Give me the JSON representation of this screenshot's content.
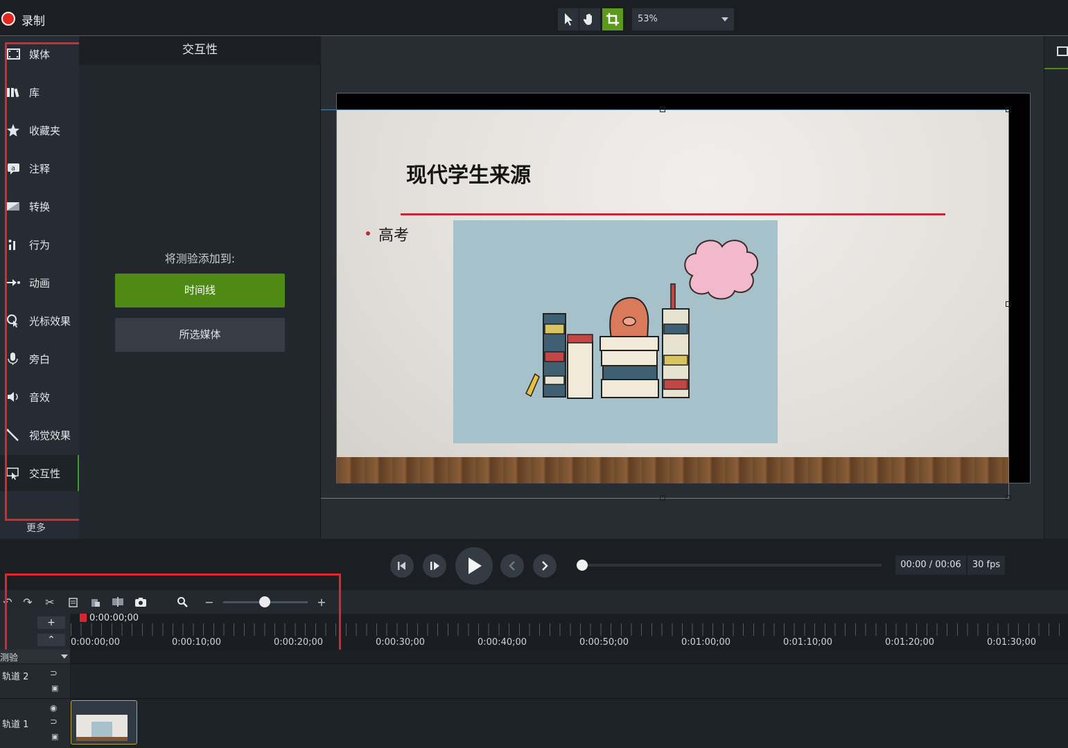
{
  "app": {
    "record_label": "录制",
    "zoom_value": "53%"
  },
  "tools": {
    "items": [
      {
        "label": "媒体",
        "icon": "film-strip-icon"
      },
      {
        "label": "库",
        "icon": "library-books-icon"
      },
      {
        "label": "收藏夹",
        "icon": "star-icon"
      },
      {
        "label": "注释",
        "icon": "annotation-icon"
      },
      {
        "label": "转换",
        "icon": "transition-icon"
      },
      {
        "label": "行为",
        "icon": "behavior-icon"
      },
      {
        "label": "动画",
        "icon": "animation-arrow-icon"
      },
      {
        "label": "光标效果",
        "icon": "cursor-effect-icon"
      },
      {
        "label": "旁白",
        "icon": "microphone-icon"
      },
      {
        "label": "音效",
        "icon": "speaker-icon"
      },
      {
        "label": "视觉效果",
        "icon": "magic-wand-icon"
      },
      {
        "label": "交互性",
        "icon": "interactivity-icon"
      }
    ],
    "active": "交互性",
    "more_label": "更多"
  },
  "panel": {
    "title": "交互性",
    "add_quiz_label": "将测验添加到:",
    "timeline_button": "时间线",
    "selected_media_button": "所选媒体"
  },
  "slide": {
    "title": "现代学生来源",
    "bullet": "高考"
  },
  "playback": {
    "time": "00:00 / 00:06",
    "fps": "30 fps"
  },
  "timeline": {
    "playhead_time": "0:00:00;00",
    "ticks": [
      "0:00:00;00",
      "0:00:10;00",
      "0:00:20;00",
      "0:00:30;00",
      "0:00:40;00",
      "0:00:50;00",
      "0:01:00;00",
      "0:01:10;00",
      "0:01:20;00",
      "0:01:30;00"
    ],
    "quiz_row_label": "测验",
    "tracks": [
      {
        "name": "轨道 2"
      },
      {
        "name": "轨道 1"
      }
    ]
  },
  "colors": {
    "accent_green": "#4e8a14",
    "highlight_red": "#e0252b",
    "record_red": "#e0261f"
  }
}
